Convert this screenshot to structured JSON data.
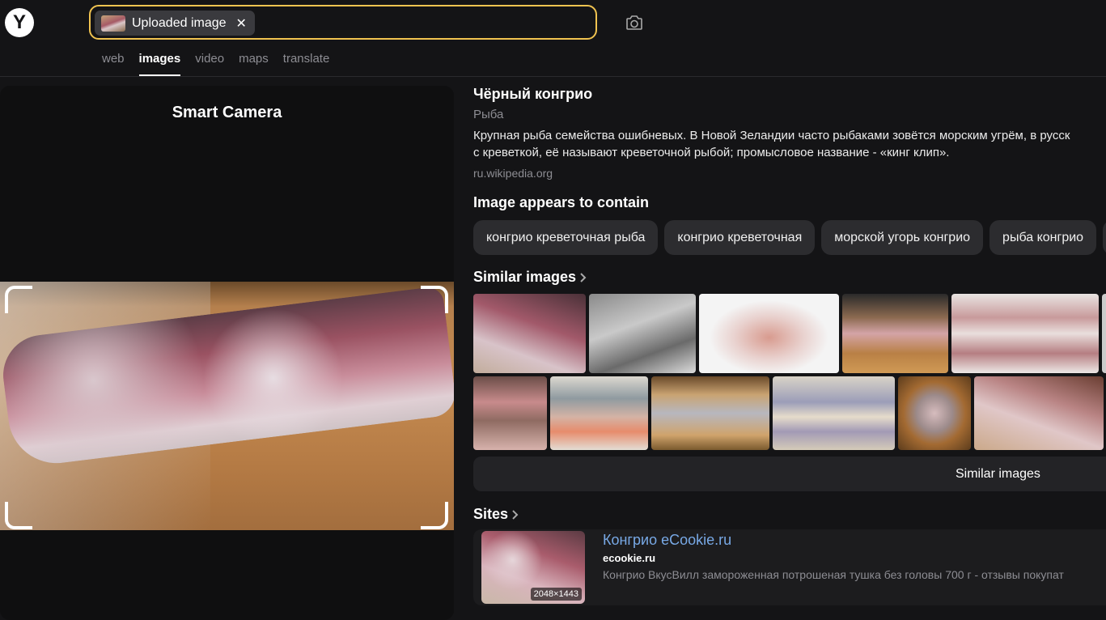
{
  "header": {
    "logo_text": "Y",
    "search_chip_label": "Uploaded image",
    "search_chip_close": "✕",
    "tabs": [
      {
        "label": "web",
        "active": false
      },
      {
        "label": "images",
        "active": true
      },
      {
        "label": "video",
        "active": false
      },
      {
        "label": "maps",
        "active": false
      },
      {
        "label": "translate",
        "active": false
      }
    ]
  },
  "left_panel": {
    "title": "Smart Camera"
  },
  "entity": {
    "title": "Чёрный конгрио",
    "subtitle": "Рыба",
    "description_line1": "Крупная рыба семейства ошибневых. В Новой Зеландии часто рыбаками зовётся морским угрём, в русск",
    "description_line2": "с креветкой, её называют креветочной рыбой; промысловое название - «кинг клип».",
    "source": "ru.wikipedia.org"
  },
  "contains": {
    "title": "Image appears to contain",
    "pills": [
      "конгрио креветочная рыба",
      "конгрио креветочная",
      "морской угорь конгрио",
      "рыба конгрио"
    ]
  },
  "similar": {
    "title": "Similar images",
    "button_label": "Similar images"
  },
  "sites": {
    "title": "Sites",
    "items": [
      {
        "title": "Конгрио eCookie.ru",
        "domain": "ecookie.ru",
        "snippet": "Конгрио ВкусВилл замороженная потрошеная тушка без головы 700 г - отзывы покупат",
        "image_size": "2048×1443"
      }
    ]
  },
  "colors": {
    "accent_border": "#f0c350",
    "link": "#78a9e6",
    "background": "#141416"
  }
}
